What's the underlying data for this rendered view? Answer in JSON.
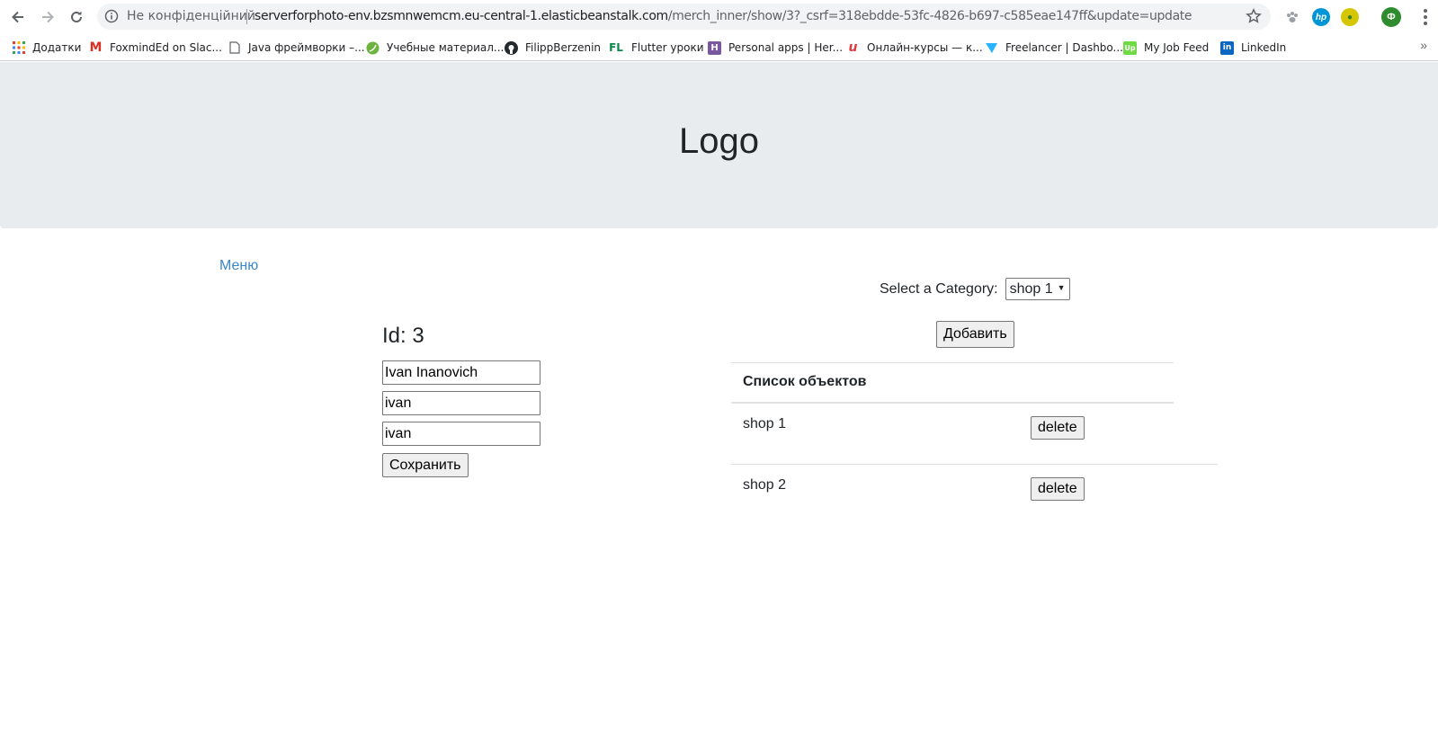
{
  "browser": {
    "security_label": "Не конфіденційний",
    "url_host": "serverforphoto-env.bzsmnwemcm.eu-central-1.elasticbeanstalk.com",
    "url_path": "/merch_inner/show/3?_csrf=318ebdde-53fc-4826-b697-c585eae147ff&update=update",
    "profile_initial": "Ф"
  },
  "bookmarks": [
    {
      "label": "Додатки",
      "icon": "apps-grid-icon"
    },
    {
      "label": "FoxmindEd on Slac...",
      "icon": "gmail-icon"
    },
    {
      "label": "Java фреймворки –...",
      "icon": "page-icon"
    },
    {
      "label": "Учебные материал...",
      "icon": "leaf-icon"
    },
    {
      "label": "FilippBerzenin",
      "icon": "github-icon"
    },
    {
      "label": "Flutter уроки",
      "icon": "fl-icon"
    },
    {
      "label": "Personal apps | Her...",
      "icon": "heroku-icon"
    },
    {
      "label": "Онлайн-курсы — к...",
      "icon": "course-icon"
    },
    {
      "label": "Freelancer | Dashbo...",
      "icon": "freelancer-icon"
    },
    {
      "label": "My Job Feed",
      "icon": "upwork-icon"
    },
    {
      "label": "LinkedIn",
      "icon": "linkedin-icon"
    }
  ],
  "header": {
    "logo": "Logo"
  },
  "nav": {
    "menu_label": "Меню"
  },
  "form": {
    "title": "Id: 3",
    "fields": [
      "Ivan Inanovich",
      "ivan",
      "ivan"
    ],
    "save_label": "Сохранить"
  },
  "category": {
    "label": "Select a Category:",
    "selected": "shop 1",
    "add_label": "Добавить"
  },
  "objects": {
    "header": "Список объектов",
    "rows": [
      {
        "name": "shop 1",
        "action": "delete"
      },
      {
        "name": "shop 2",
        "action": "delete"
      }
    ]
  },
  "colors": {
    "jumbotron_bg": "#e9ecef",
    "link": "#3b86c6"
  }
}
